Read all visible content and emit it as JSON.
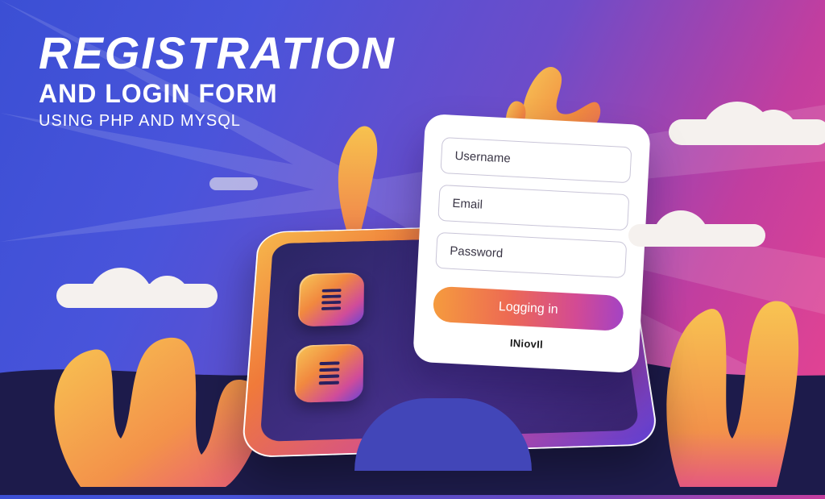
{
  "heading": {
    "line1": "REGISTRATION",
    "line2": "AND LOGIN FORM",
    "line3": "USING PHP AND MYSQL"
  },
  "form": {
    "username_placeholder": "Username",
    "email_placeholder": "Email",
    "password_placeholder": "Password",
    "submit_label": "Logging in",
    "brand": "INiovІl"
  },
  "icons": {
    "tile": "list-icon"
  },
  "colors": {
    "accent_gradient_start": "#f59b3e",
    "accent_gradient_end": "#a443c4",
    "bg_start": "#3b4fd4",
    "bg_end": "#e84490"
  }
}
